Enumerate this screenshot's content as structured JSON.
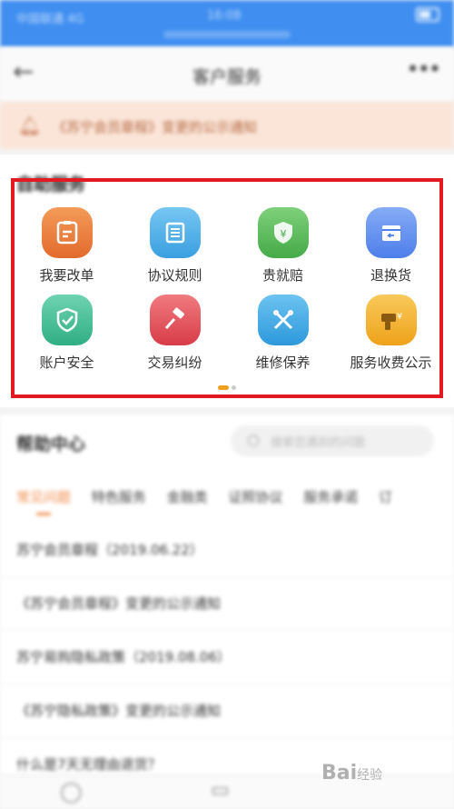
{
  "status_bar": {
    "carrier": "中国联通  4G",
    "time": "16:08"
  },
  "nav": {
    "back_icon": "back-arrow-icon",
    "title": "客户服务",
    "more_icon": "more-icon"
  },
  "notice": {
    "text": "《苏宁会员章程》变更的公示通知",
    "icon": "bell-icon"
  },
  "self_service": {
    "title": "自助服务",
    "items": [
      {
        "label": "我要改单",
        "icon": "edit-order-icon",
        "color": "#ee7d3a"
      },
      {
        "label": "协议规则",
        "icon": "document-list-icon",
        "color": "#4bb0ea"
      },
      {
        "label": "贵就赔",
        "icon": "shield-yuan-icon",
        "color": "#5cbf5a"
      },
      {
        "label": "退换货",
        "icon": "return-box-icon",
        "color": "#5f8ff0"
      },
      {
        "label": "账户安全",
        "icon": "shield-check-icon",
        "color": "#3fc095"
      },
      {
        "label": "交易纠纷",
        "icon": "gavel-icon",
        "color": "#e8505a"
      },
      {
        "label": "维修保养",
        "icon": "wrench-icon",
        "color": "#39a9e6"
      },
      {
        "label": "服务收费公示",
        "icon": "drill-yuan-icon",
        "color": "#f5b22a"
      }
    ]
  },
  "help_center": {
    "title": "帮助中心",
    "search_placeholder": "搜索您遇到的问题",
    "tabs": [
      "常见问题",
      "特色服务",
      "金融类",
      "证照协议",
      "服务承诺",
      "订"
    ],
    "active_tab": 0,
    "items": [
      "苏宁会员章程（2019.06.22）",
      "《苏宁会员章程》变更的公示通知",
      "苏宁易购隐私政策（2019.08.06）",
      "《苏宁隐私政策》变更的公示通知",
      "什么是7天无理由退货？"
    ]
  },
  "bottom_bar": {
    "icons": [
      "chat-icon",
      "clipboard-icon"
    ]
  },
  "watermark": {
    "brand": "Bai",
    "suffix": "经验"
  }
}
